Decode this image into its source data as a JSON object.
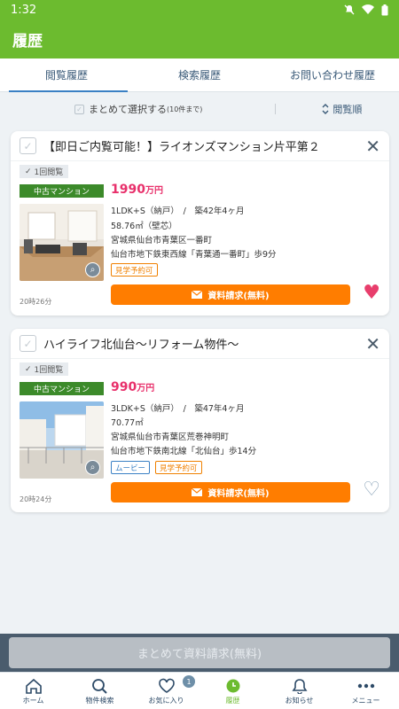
{
  "status_bar": {
    "time": "1:32"
  },
  "header": {
    "title": "履歴"
  },
  "tabs": [
    {
      "label": "閲覧履歴",
      "active": true
    },
    {
      "label": "検索履歴",
      "active": false
    },
    {
      "label": "お問い合わせ履歴",
      "active": false
    }
  ],
  "select_row": {
    "label": "まとめて選択する",
    "sublabel": "(10件まで)",
    "sort_label": "閲覧順"
  },
  "cards": [
    {
      "title": "【即日ご内覧可能！】ライオンズマンション片平第２",
      "views": "1回閲覧",
      "type": "中古マンション",
      "price_value": "1990",
      "price_unit": "万円",
      "layout_age": "1LDK+S（納戸）　/　築42年4ヶ月",
      "area": "58.76㎡（壁芯）",
      "address": "宮城県仙台市青葉区一番町",
      "access": "仙台市地下鉄東西線「青葉通一番町」歩9分",
      "tags": [
        "見学予約可"
      ],
      "request_label": "資料請求(無料)",
      "time": "20時26分",
      "favorited": true
    },
    {
      "title": "ハイライフ北仙台〜リフォーム物件〜",
      "views": "1回閲覧",
      "type": "中古マンション",
      "price_value": "990",
      "price_unit": "万円",
      "layout_age": "3LDK+S（納戸）　/　築47年4ヶ月",
      "area": "70.77㎡",
      "address": "宮城県仙台市青葉区荒巻神明町",
      "access": "仙台市地下鉄南北線「北仙台」歩14分",
      "tags": [
        "ムービー",
        "見学予約可"
      ],
      "request_label": "資料請求(無料)",
      "time": "20時24分",
      "favorited": false
    }
  ],
  "bulk_button": {
    "label": "まとめて資料請求(無料)"
  },
  "bottom_nav": [
    {
      "label": "ホーム",
      "icon": "home-icon"
    },
    {
      "label": "物件検索",
      "icon": "search-icon"
    },
    {
      "label": "お気に入り",
      "icon": "heart-icon",
      "badge": "1"
    },
    {
      "label": "履歴",
      "icon": "history-icon",
      "active": true
    },
    {
      "label": "お知らせ",
      "icon": "bell-icon"
    },
    {
      "label": "メニュー",
      "icon": "more-icon"
    }
  ],
  "colors": {
    "brand_green": "#6cbb2f",
    "price_pink": "#e8306b",
    "cta_orange": "#ff7d00"
  }
}
